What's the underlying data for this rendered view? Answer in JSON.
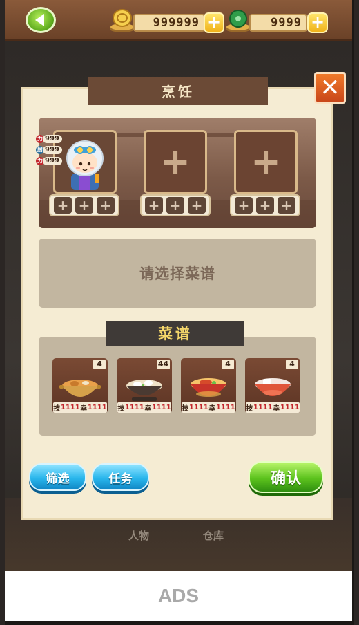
{
  "top_bar": {
    "coins_value": "999999",
    "gems_value": "9999"
  },
  "dialog": {
    "title": "烹饪",
    "recipe_prompt": "请选择菜谱",
    "menu_title": "菜谱"
  },
  "chef_stats": [
    {
      "icon": "力",
      "value": "999",
      "color": "#c2272d"
    },
    {
      "icon": "厨",
      "value": "999",
      "color": "#2a6f9a"
    },
    {
      "icon": "力",
      "value": "999",
      "color": "#c2272d"
    }
  ],
  "recipes": [
    {
      "count": "4",
      "skill_label": "技",
      "skill_value": "1111",
      "luck_label": "幸",
      "luck_value": "1111",
      "dish_icon": "braised-pot-dish"
    },
    {
      "count": "44",
      "skill_label": "技",
      "skill_value": "1111",
      "luck_label": "幸",
      "luck_value": "1111",
      "dish_icon": "dumpling-bowl-dish"
    },
    {
      "count": "4",
      "skill_label": "技",
      "skill_value": "1111",
      "luck_label": "幸",
      "luck_value": "1111",
      "dish_icon": "noodle-bowl-dish"
    },
    {
      "count": "4",
      "skill_label": "技",
      "skill_value": "1111",
      "luck_label": "幸",
      "luck_value": "1111",
      "dish_icon": "tofu-bowl-dish"
    }
  ],
  "buttons": {
    "filter": "筛选",
    "task": "任务",
    "confirm": "确认"
  },
  "background_labels": {
    "characters": "人物",
    "warehouse": "仓库"
  },
  "ads_label": "ADS"
}
